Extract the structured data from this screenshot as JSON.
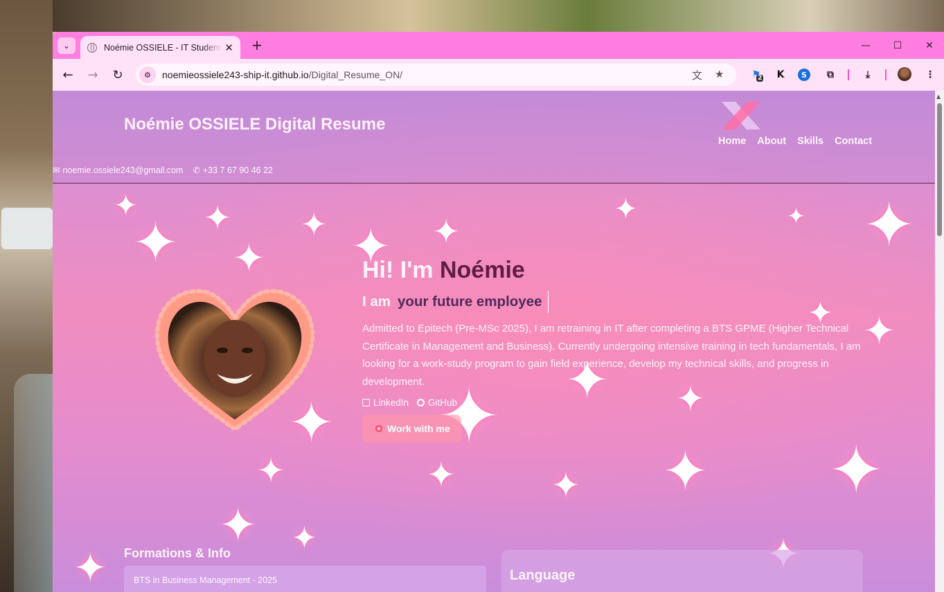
{
  "browser": {
    "tab_title": "Noémie OSSIELE - IT Student Resume",
    "url_host": "noemieossiele243-ship-it.github.io",
    "url_path": "/Digital_Resume_ON/",
    "extension_badge": "2",
    "extension_k": "K"
  },
  "header": {
    "brand": "Noémie OSSIELE Digital Resume",
    "nav": [
      "Home",
      "About",
      "Skills",
      "Contact"
    ],
    "email": "noemie.ossiele243@gmail.com",
    "phone": "+33 7 67 90 46 22"
  },
  "hero": {
    "greeting": "Hi! I'm ",
    "name": "Noémie",
    "iam_prefix": "I am",
    "role": "your future employee",
    "bio": "Admitted to Epitech (Pre-MSc 2025), I am retraining in IT after completing a BTS GPME (Higher Technical Certificate in Management and Business). Currently undergoing intensive training in tech fundamentals, I am looking for a work-study program to gain field experience, develop my technical skills, and progress in development.",
    "link_linkedin": "LinkedIn",
    "link_github": "GitHub",
    "cta": "Work with me"
  },
  "sections": {
    "formations_title": "Formations & Info",
    "formations_first": "BTS in Business Management - 2025",
    "language_title": "Language"
  },
  "colors": {
    "tabbar": "#ff7ee0",
    "toolbar": "#ffe2f7",
    "accent_name": "#5e1d45",
    "accent_role": "#4d2a5c"
  }
}
